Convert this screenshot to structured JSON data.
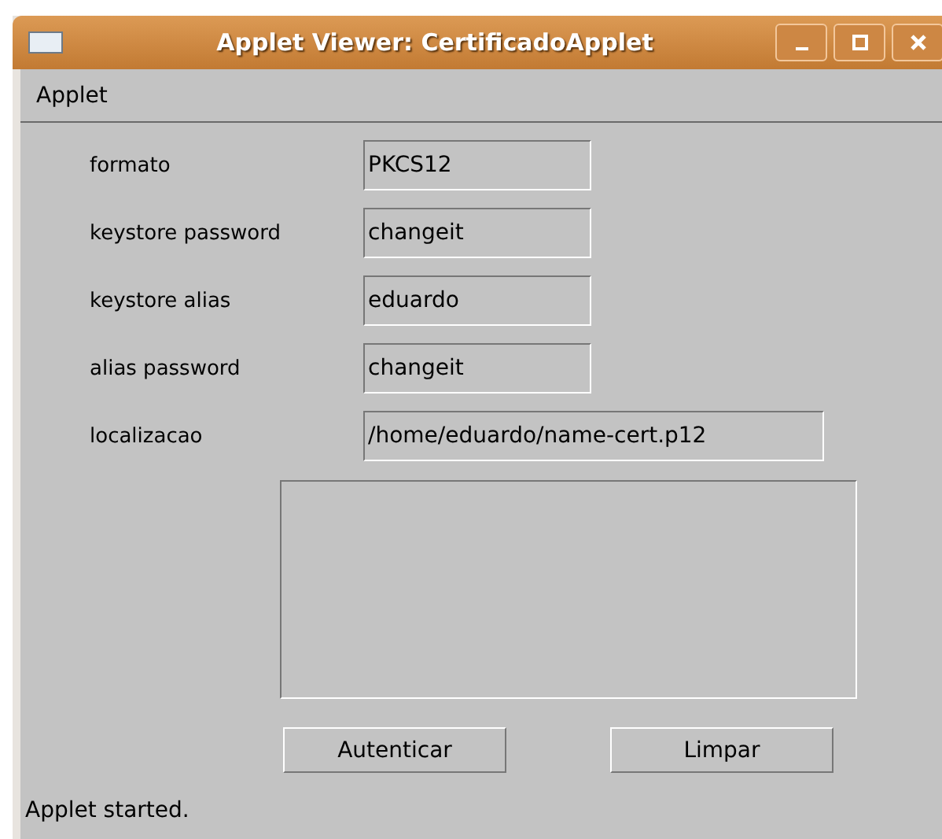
{
  "window": {
    "title": "Applet Viewer: CertificadoApplet"
  },
  "menu": [
    "Applet"
  ],
  "fields": [
    {
      "label": "formato",
      "value": "PKCS12",
      "kind": "short"
    },
    {
      "label": "keystore password",
      "value": "changeit",
      "kind": "short"
    },
    {
      "label": "keystore alias",
      "value": "eduardo",
      "kind": "short"
    },
    {
      "label": "alias password",
      "value": "changeit",
      "kind": "short"
    },
    {
      "label": "localizacao",
      "value": "/home/eduardo/name-cert.p12",
      "kind": "long"
    }
  ],
  "buttons": [
    "Autenticar",
    "Limpar"
  ],
  "status_bar": "Applet started."
}
